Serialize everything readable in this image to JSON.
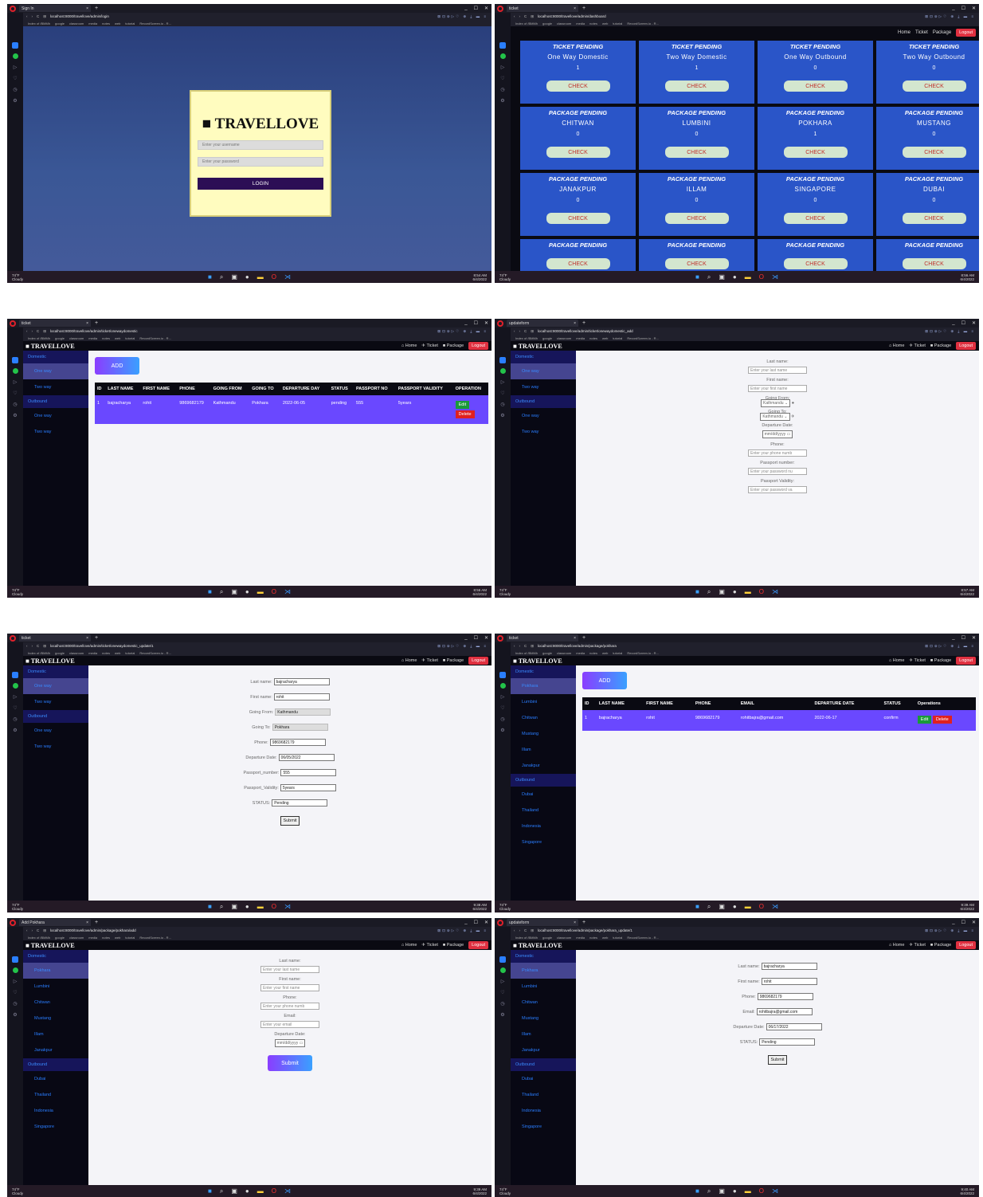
{
  "browser": {
    "new_tab": "+",
    "minimize": "_",
    "maximize": "☐",
    "close": "✕",
    "tab_close": "×",
    "bookmarks": [
      "Index of /BMMh",
      "google",
      "classroom",
      "media",
      "notes",
      "web",
      "tutorial",
      "RecordScreen.io - R..."
    ],
    "weather_temp": "74°F",
    "weather_desc": "Cloudy",
    "date": "6/4/2022"
  },
  "screens": {
    "login": {
      "tab": "Sign In",
      "url": "localhost:8000/travellove/admin/login",
      "time": "8:54 AM",
      "brand": "TRAVELLOVE",
      "username_placeholder": "Enter your username",
      "password_placeholder": "Enter your password",
      "login": "LOGIN"
    },
    "dashboard": {
      "tab": "ticket",
      "url": "localhost:8000/travellove/admin/dashboard",
      "time": "8:56 AM",
      "nav": [
        "Home",
        "Ticket",
        "Package"
      ],
      "logout": "Logout",
      "check": "CHECK",
      "cards": [
        {
          "head": "TICKET PENDING",
          "name": "One Way Domestic",
          "count": "1"
        },
        {
          "head": "TICKET PENDING",
          "name": "Two Way Domestic",
          "count": "1"
        },
        {
          "head": "TICKET PENDING",
          "name": "One Way Outbound",
          "count": "0"
        },
        {
          "head": "TICKET PENDING",
          "name": "Two Way Outbound",
          "count": "0"
        },
        {
          "head": "PACKAGE PENDING",
          "name": "CHITWAN",
          "count": "0"
        },
        {
          "head": "PACKAGE PENDING",
          "name": "LUMBINI",
          "count": "0"
        },
        {
          "head": "PACKAGE PENDING",
          "name": "POKHARA",
          "count": "1"
        },
        {
          "head": "PACKAGE PENDING",
          "name": "MUSTANG",
          "count": "0"
        },
        {
          "head": "PACKAGE PENDING",
          "name": "JANAKPUR",
          "count": "0"
        },
        {
          "head": "PACKAGE PENDING",
          "name": "ILLAM",
          "count": "0"
        },
        {
          "head": "PACKAGE PENDING",
          "name": "SINGAPORE",
          "count": "0"
        },
        {
          "head": "PACKAGE PENDING",
          "name": "DUBAI",
          "count": "0"
        },
        {
          "head": "PACKAGE PENDING",
          "name": "",
          "count": ""
        },
        {
          "head": "PACKAGE PENDING",
          "name": "",
          "count": ""
        },
        {
          "head": "PACKAGE PENDING",
          "name": "",
          "count": ""
        },
        {
          "head": "PACKAGE PENDING",
          "name": "",
          "count": ""
        }
      ]
    },
    "ticket_list": {
      "tab": "ticket",
      "url": "localhost:8000/travellove/admin/ticket/onewaydomestic",
      "time": "8:56 AM",
      "add": "ADD",
      "headers": [
        "ID",
        "LAST NAME",
        "FIRST NAME",
        "PHONE",
        "GOING FROM",
        "GOING TO",
        "DEPARTURE DAY",
        "STATUS",
        "PASSPORT NO",
        "PASSPORT VALIDITY",
        "OPERATION"
      ],
      "row": [
        "1",
        "bajracharya",
        "rohit",
        "9869682179",
        "Kathmandu",
        "Pokhara",
        "2022-06-05",
        "pending",
        "555",
        "5years"
      ],
      "edit": "Edit",
      "delete": "Delete"
    },
    "ticket_add": {
      "tab": "updateform",
      "url": "localhost:8000/travellove/admin/ticket/onewaydomestic_add",
      "time": "8:57 AM",
      "fields": [
        {
          "label": "Last name:",
          "ph": "Enter your last name"
        },
        {
          "label": "First name:",
          "ph": "Enter your first name"
        }
      ],
      "going_from": "Going From:",
      "going_to": "Going To:",
      "city": "Kathmandu",
      "departure": "Departure Date:",
      "date_ph": "mm/dd/yyyy",
      "fields2": [
        {
          "label": "Phone:",
          "ph": "Enter your phone numb"
        },
        {
          "label": "Passport number:",
          "ph": "Enter your password nu"
        },
        {
          "label": "Passport Validity:",
          "ph": "Enter your password va"
        }
      ]
    },
    "ticket_update": {
      "tab": "ticket",
      "url": "localhost:8000/travellove/admin/ticket/onewaydomestic_update/1",
      "time": "9:38 AM",
      "rows": [
        {
          "label": "Last name:",
          "value": "bajracharya"
        },
        {
          "label": "First name:",
          "value": "rohit"
        },
        {
          "label": "Going From:",
          "value": "Kathmandu"
        },
        {
          "label": "Going To:",
          "value": "Pokhara"
        },
        {
          "label": "Phone:",
          "value": "9869682179"
        },
        {
          "label": "Departure Date:",
          "value": "06/05/2022"
        },
        {
          "label": "Passport_number:",
          "value": "555"
        },
        {
          "label": "Passport_Validity:",
          "value": "5years"
        },
        {
          "label": "STATUS:",
          "value": "Pending"
        }
      ],
      "submit": "Submit"
    },
    "package_list": {
      "tab": "ticket",
      "url": "localhost:8000/travellove/admin/package/pokhara",
      "time": "9:39 AM",
      "headers": [
        "ID",
        "LAST NAME",
        "FIRST NAME",
        "PHONE",
        "EMAIL",
        "DEPARTURE DATE",
        "STATUS",
        "Operations"
      ],
      "row": [
        "1",
        "bajracharya",
        "rohit",
        "9869682179",
        "rohitbajra@gmail.com",
        "2022-06-17",
        "confirm"
      ]
    },
    "package_add": {
      "tab": "Add Pokhara",
      "url": "localhost:8000/travellove/admin/package/pokhara/add",
      "time": "9:39 AM",
      "fields": [
        {
          "label": "Last name:",
          "ph": "Enter your last name"
        },
        {
          "label": "First name:",
          "ph": "Enter your first name"
        },
        {
          "label": "Phone:",
          "ph": "Enter your phone numb"
        },
        {
          "label": "Email:",
          "ph": "Enter your email"
        }
      ]
    },
    "package_update": {
      "tab": "updateform",
      "url": "localhost:8000/travellove/admin/package/pokhara_update/1",
      "time": "9:40 AM",
      "rows": [
        {
          "label": "Last name:",
          "value": "bajracharya"
        },
        {
          "label": "First name:",
          "value": "rohit"
        },
        {
          "label": "Phone:",
          "value": "9869682179"
        },
        {
          "label": "Email:",
          "value": "rohitbajra@gmail.com"
        },
        {
          "label": "Departure Date:",
          "value": "06/17/2022"
        },
        {
          "label": "STATUS:",
          "value": "Pending"
        }
      ]
    }
  },
  "admin": {
    "logo": "TRAVELLOVE",
    "nav": [
      "Home",
      "Ticket",
      "Package"
    ],
    "logout": "Logout",
    "ticket_side": {
      "domestic": "Domestic",
      "outbound": "Outbound",
      "one": "One way",
      "two": "Two way"
    },
    "package_side": {
      "domestic": "Domestic",
      "outbound": "Outbound",
      "dom": [
        "Pokhara",
        "Lumbini",
        "Chitwan",
        "Mustang",
        "Illam",
        "Janakpur"
      ],
      "out": [
        "Dubai",
        "Thailand",
        "Indonesia",
        "Singapore"
      ]
    }
  }
}
